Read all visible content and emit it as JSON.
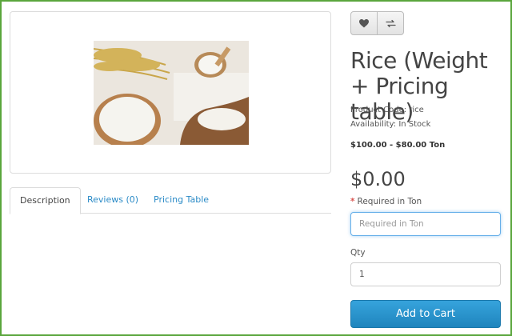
{
  "product": {
    "title": "Rice (Weight + Pricing table)",
    "code_label": "Product Code: rice",
    "availability_label": "Availability: In Stock",
    "price_range": "$100.00 - $80.00 Ton",
    "price": "$0.00"
  },
  "actions": {
    "wishlist_icon": "heart-icon",
    "compare_icon": "exchange-icon"
  },
  "tabs": [
    {
      "label": "Description",
      "active": true
    },
    {
      "label": "Reviews (0)",
      "active": false
    },
    {
      "label": "Pricing Table",
      "active": false
    }
  ],
  "form": {
    "required_star": "*",
    "required_label": "Required in Ton",
    "weight_placeholder": "Required in Ton",
    "qty_label": "Qty",
    "qty_value": "1",
    "cart_label": "Add to Cart"
  },
  "colors": {
    "accent": "#2b8bc7",
    "cart_button": "#1f85bd",
    "required_star": "#d9534f"
  }
}
